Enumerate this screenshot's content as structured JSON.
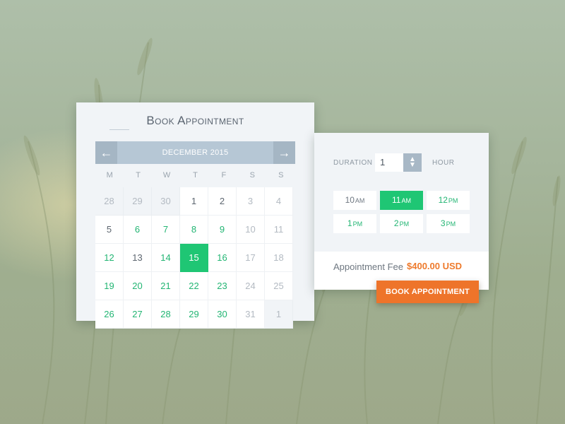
{
  "calendar": {
    "title": "Book Appointment",
    "month_label": "DECEMBER 2015",
    "prev_icon": "arrow-left-icon",
    "next_icon": "arrow-right-icon",
    "weekdays": [
      "M",
      "T",
      "W",
      "T",
      "F",
      "S",
      "S"
    ],
    "days": [
      {
        "label": "28",
        "state": "inactive"
      },
      {
        "label": "29",
        "state": "inactive"
      },
      {
        "label": "30",
        "state": "inactive"
      },
      {
        "label": "1",
        "state": "normal"
      },
      {
        "label": "2",
        "state": "normal"
      },
      {
        "label": "3",
        "state": "muted"
      },
      {
        "label": "4",
        "state": "muted"
      },
      {
        "label": "5",
        "state": "normal"
      },
      {
        "label": "6",
        "state": "available"
      },
      {
        "label": "7",
        "state": "available"
      },
      {
        "label": "8",
        "state": "available"
      },
      {
        "label": "9",
        "state": "available"
      },
      {
        "label": "10",
        "state": "muted"
      },
      {
        "label": "11",
        "state": "muted"
      },
      {
        "label": "12",
        "state": "available"
      },
      {
        "label": "13",
        "state": "normal"
      },
      {
        "label": "14",
        "state": "available"
      },
      {
        "label": "15",
        "state": "selected"
      },
      {
        "label": "16",
        "state": "available"
      },
      {
        "label": "17",
        "state": "muted"
      },
      {
        "label": "18",
        "state": "muted"
      },
      {
        "label": "19",
        "state": "available"
      },
      {
        "label": "20",
        "state": "available"
      },
      {
        "label": "21",
        "state": "available"
      },
      {
        "label": "22",
        "state": "available"
      },
      {
        "label": "23",
        "state": "available"
      },
      {
        "label": "24",
        "state": "muted"
      },
      {
        "label": "25",
        "state": "muted"
      },
      {
        "label": "26",
        "state": "available"
      },
      {
        "label": "27",
        "state": "available"
      },
      {
        "label": "28",
        "state": "available"
      },
      {
        "label": "29",
        "state": "available"
      },
      {
        "label": "30",
        "state": "available"
      },
      {
        "label": "31",
        "state": "muted"
      },
      {
        "label": "1",
        "state": "inactive"
      }
    ]
  },
  "time": {
    "duration_label": "DURATION",
    "duration_value": "1",
    "hour_label": "HOUR",
    "stepper_icon": "up-down-chevron-icon",
    "slots": [
      {
        "hour": "10",
        "ampm": "AM",
        "state": "disabled"
      },
      {
        "hour": "11",
        "ampm": "AM",
        "state": "selected"
      },
      {
        "hour": "12",
        "ampm": "PM",
        "state": "available"
      },
      {
        "hour": "1",
        "ampm": "PM",
        "state": "available"
      },
      {
        "hour": "2",
        "ampm": "PM",
        "state": "available"
      },
      {
        "hour": "3",
        "ampm": "PM",
        "state": "available"
      }
    ]
  },
  "fee": {
    "label": "Appointment Fee",
    "value": "$400.00 USD"
  },
  "book_button_label": "BOOK APPOINTMENT",
  "colors": {
    "accent_green": "#1fc674",
    "accent_orange": "#ee742a",
    "header_blue": "#b6c7d5"
  }
}
